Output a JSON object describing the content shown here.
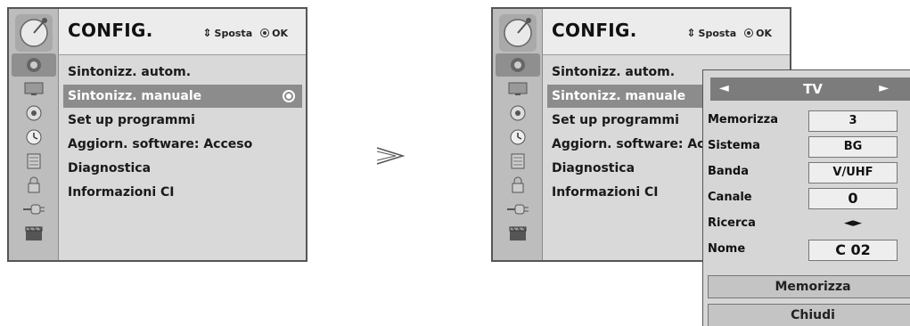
{
  "left_panel": {
    "title": "CONFIG.",
    "hint_move": "Sposta",
    "hint_ok": "OK",
    "menu": [
      "Sintonizz. autom.",
      "Sintonizz. manuale",
      "Set up programmi",
      "Aggiorn. software: Acceso",
      "Diagnostica",
      "Informazioni CI"
    ],
    "selected_index": 1
  },
  "right_panel": {
    "title": "CONFIG.",
    "hint_move": "Sposta",
    "hint_ok": "OK",
    "menu": [
      "Sintonizz. autom.",
      "Sintonizz. manuale",
      "Set up programmi",
      "Aggiorn. software: Acc",
      "Diagnostica",
      "Informazioni CI"
    ],
    "selected_index": 1
  },
  "side_icons": [
    "satellite-icon",
    "monitor-icon",
    "speaker-icon",
    "clock-icon",
    "lock-icon",
    "padlock-icon",
    "plug-icon",
    "clapperboard-icon"
  ],
  "popup": {
    "title": "TV",
    "nav_left": "◄",
    "nav_right": "►",
    "rows": [
      {
        "label": "Memorizza",
        "value": "3"
      },
      {
        "label": "Sistema",
        "value": "BG"
      },
      {
        "label": "Banda",
        "value": "V/UHF"
      },
      {
        "label": "Canale",
        "value": "0"
      },
      {
        "label": "Ricerca",
        "value": "◄►"
      },
      {
        "label": "Nome",
        "value": "C  02"
      }
    ],
    "store_button": "Memorizza",
    "close_button": "Chiudi"
  },
  "colors": {
    "sidebar": "#bdbdbd",
    "header": "#ececec",
    "selected": "#8c8c8c",
    "popup_bg": "#d6d6d6"
  }
}
